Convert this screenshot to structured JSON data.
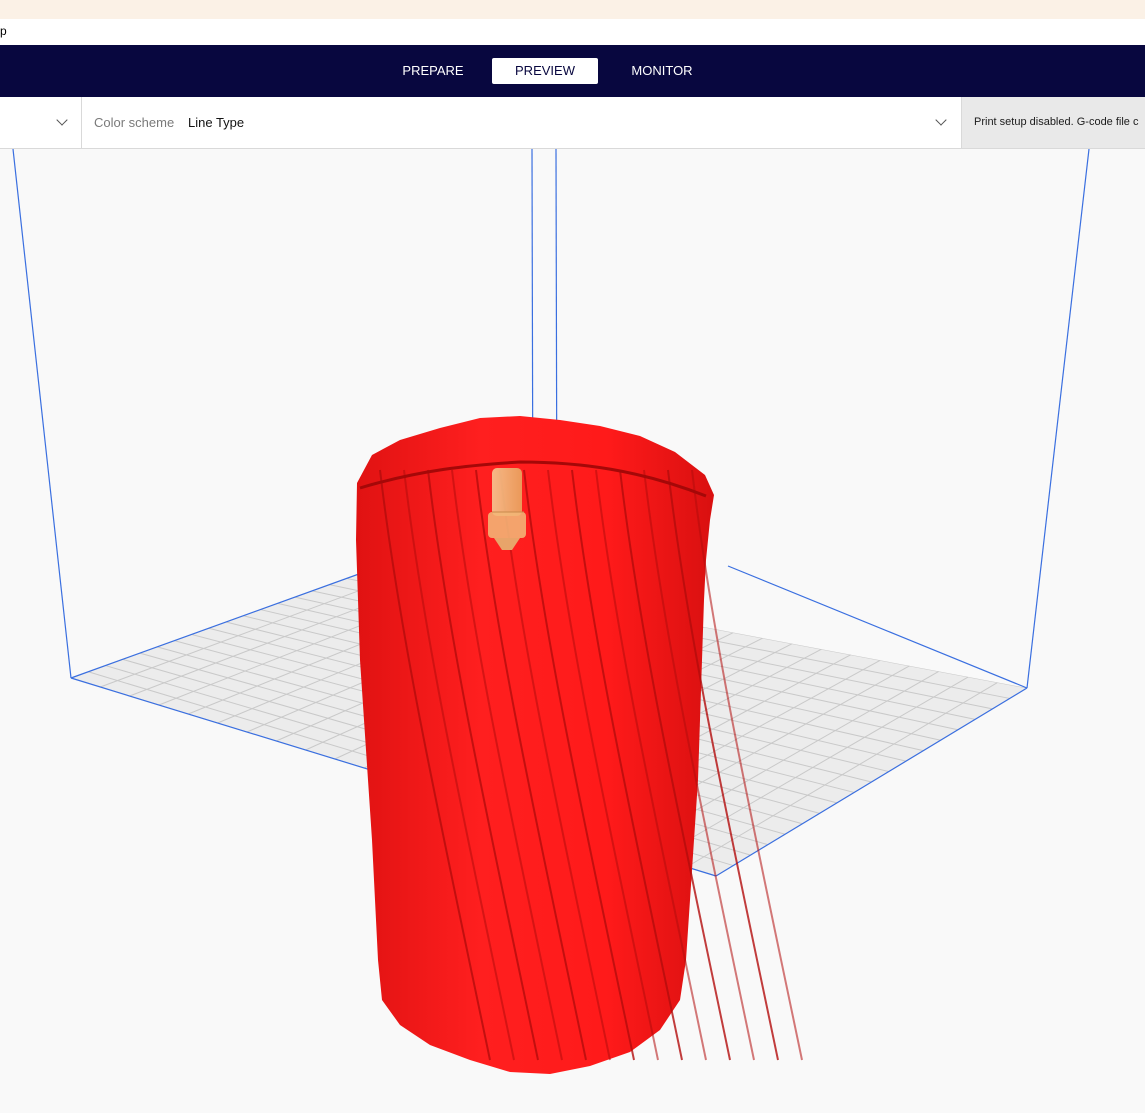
{
  "menu": {
    "fragment": "p"
  },
  "stages": {
    "tabs": [
      {
        "label": "PREPARE",
        "active": false
      },
      {
        "label": "PREVIEW",
        "active": true
      },
      {
        "label": "MONITOR",
        "active": false
      }
    ]
  },
  "view_bar": {
    "color_scheme_label": "Color scheme",
    "color_scheme_value": "Line Type",
    "print_setup_text": "Print setup disabled. G-code file c"
  },
  "colors": {
    "stage_bar": "#08073f",
    "model_red": "#ff1a1a",
    "model_shadow": "#c30f0f",
    "nozzle": "#f2b678",
    "build_volume_lines": "#3a6fe0",
    "grid_plate": "#e8e8e8"
  },
  "icons": {
    "view_dropdown": "chevron-down-icon",
    "color_scheme_dropdown": "chevron-down-icon"
  }
}
